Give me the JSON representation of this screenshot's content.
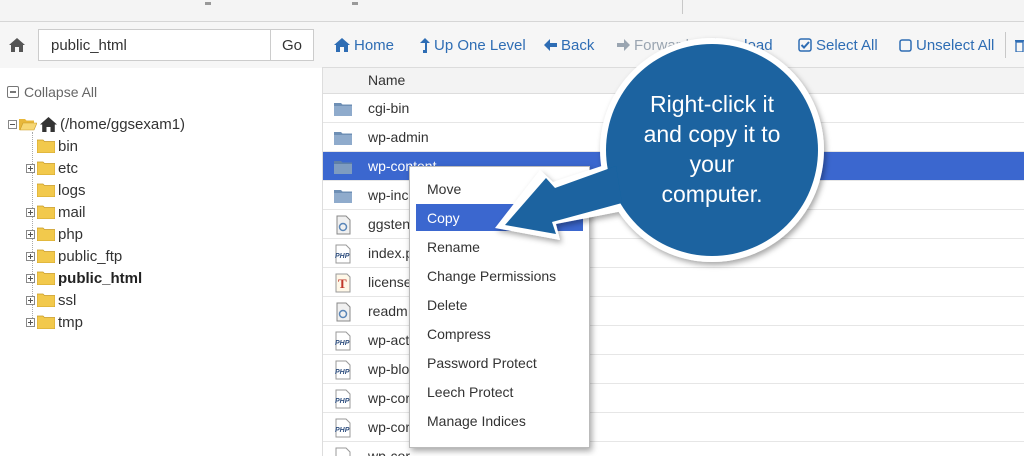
{
  "path_bar": {
    "path_value": "public_html",
    "go_label": "Go"
  },
  "toolbar": {
    "home": "Home",
    "up_one_level": "Up One Level",
    "back": "Back",
    "forward": "Forward",
    "reload": "Reload",
    "select_all": "Select All",
    "unselect_all": "Unselect All"
  },
  "tree": {
    "collapse_all": "Collapse All",
    "root": "(/home/ggsexam1)",
    "items": [
      {
        "label": "bin",
        "expandable": false
      },
      {
        "label": "etc",
        "expandable": true
      },
      {
        "label": "logs",
        "expandable": false
      },
      {
        "label": "mail",
        "expandable": true
      },
      {
        "label": "php",
        "expandable": true
      },
      {
        "label": "public_ftp",
        "expandable": true
      },
      {
        "label": "public_html",
        "expandable": true,
        "bold": true
      },
      {
        "label": "ssl",
        "expandable": true
      },
      {
        "label": "tmp",
        "expandable": true
      }
    ]
  },
  "file_list": {
    "column_name": "Name",
    "rows": [
      {
        "name": "cgi-bin",
        "icon": "folder-icon"
      },
      {
        "name": "wp-admin",
        "icon": "folder-icon"
      },
      {
        "name": "wp-content",
        "icon": "folder-icon",
        "selected": true
      },
      {
        "name": "wp-inc",
        "icon": "folder-icon"
      },
      {
        "name": "ggsten",
        "icon": "generic-file-icon"
      },
      {
        "name": "index.p",
        "icon": "php-file-icon"
      },
      {
        "name": "license",
        "icon": "text-file-icon"
      },
      {
        "name": "readm",
        "icon": "generic-file-icon"
      },
      {
        "name": "wp-act",
        "icon": "php-file-icon"
      },
      {
        "name": "wp-blo",
        "icon": "php-file-icon"
      },
      {
        "name": "wp-cor",
        "icon": "php-file-icon"
      },
      {
        "name": "wp-cor",
        "icon": "php-file-icon"
      },
      {
        "name": "wp-cor",
        "icon": "php-file-icon"
      }
    ]
  },
  "context_menu": {
    "items": [
      "Move",
      "Copy",
      "Rename",
      "Change Permissions",
      "Delete",
      "Compress",
      "Password Protect",
      "Leech Protect",
      "Manage Indices"
    ],
    "active": "Copy"
  },
  "callout": {
    "lines": [
      "Right-click it",
      "and copy it to",
      "your",
      "computer."
    ]
  },
  "colors": {
    "link_blue": "#2e6db4",
    "selection_blue": "#3b67cf",
    "callout_blue": "#1a64a0",
    "folder_yellow": "#f2c94c",
    "folder_blue": "#6e8fb5"
  }
}
